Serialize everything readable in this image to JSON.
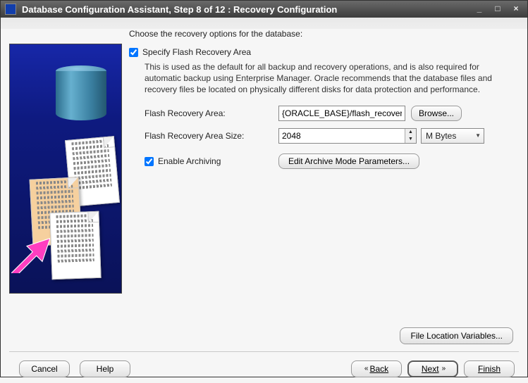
{
  "titlebar": {
    "title": "Database Configuration Assistant, Step 8 of 12 : Recovery Configuration"
  },
  "form": {
    "instruction": "Choose the recovery options for the database:",
    "specify_flash": {
      "label": "Specify Flash Recovery Area",
      "checked": true,
      "description": "This is used as the default for all backup and recovery operations, and is also required for automatic backup using Enterprise Manager. Oracle recommends that the database files and recovery files be located on physically different disks for data protection and performance."
    },
    "fra_path": {
      "label": "Flash Recovery Area:",
      "value": "{ORACLE_BASE}/flash_recovery_",
      "browse": "Browse..."
    },
    "fra_size": {
      "label": "Flash Recovery Area Size:",
      "value": "2048",
      "unit": "M Bytes"
    },
    "archiving": {
      "label": "Enable Archiving",
      "checked": true,
      "edit_btn": "Edit Archive Mode Parameters..."
    },
    "file_loc_btn": "File Location Variables..."
  },
  "footer": {
    "cancel": "Cancel",
    "help": "Help",
    "back": "Back",
    "next": "Next",
    "finish": "Finish"
  }
}
